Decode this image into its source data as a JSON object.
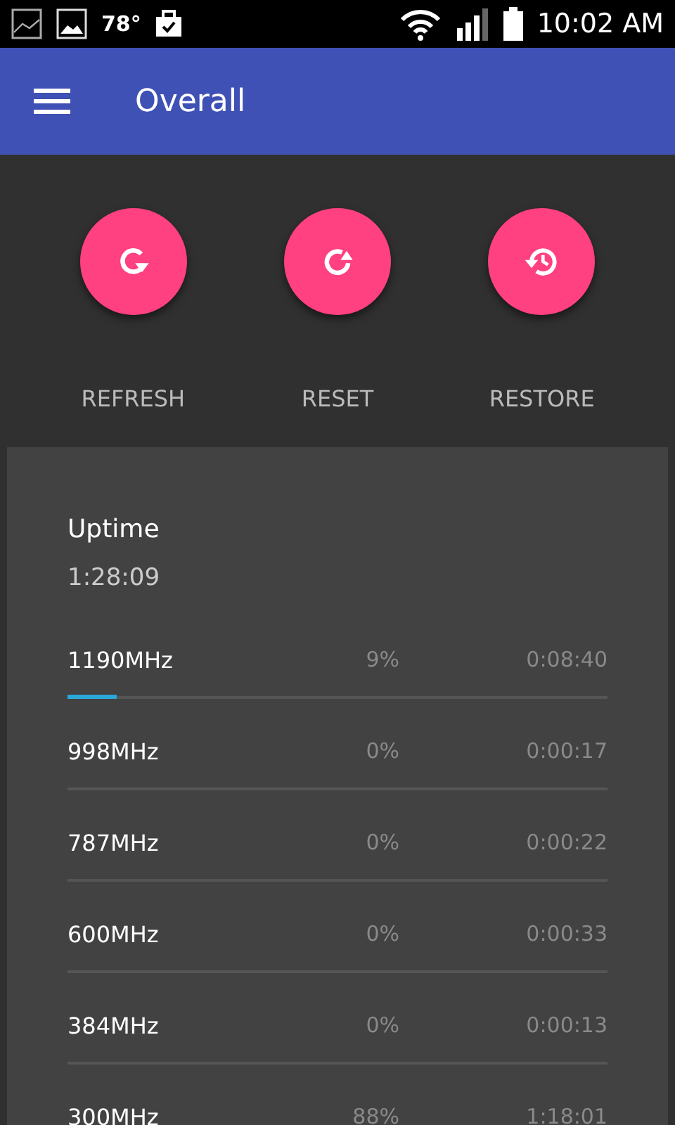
{
  "status_bar": {
    "temperature": "78°",
    "time": "10:02 AM"
  },
  "app_bar": {
    "title": "Overall"
  },
  "actions": [
    {
      "kind": "refresh",
      "label": "REFRESH"
    },
    {
      "kind": "reset",
      "label": "RESET"
    },
    {
      "kind": "restore",
      "label": "RESTORE"
    }
  ],
  "uptime": {
    "title": "Uptime",
    "value": "1:28:09"
  },
  "frequencies": [
    {
      "name": "1190MHz",
      "percent": "9%",
      "time": "0:08:40",
      "level": 0.09
    },
    {
      "name": "998MHz",
      "percent": "0%",
      "time": "0:00:17"
    },
    {
      "name": "787MHz",
      "percent": "0%",
      "time": "0:00:22"
    },
    {
      "name": "600MHz",
      "percent": "0%",
      "time": "0:00:33"
    },
    {
      "name": "384MHz",
      "percent": "0%",
      "time": "0:00:13"
    },
    {
      "name": "300MHz",
      "percent": "88%",
      "time": "1:18:01"
    }
  ]
}
